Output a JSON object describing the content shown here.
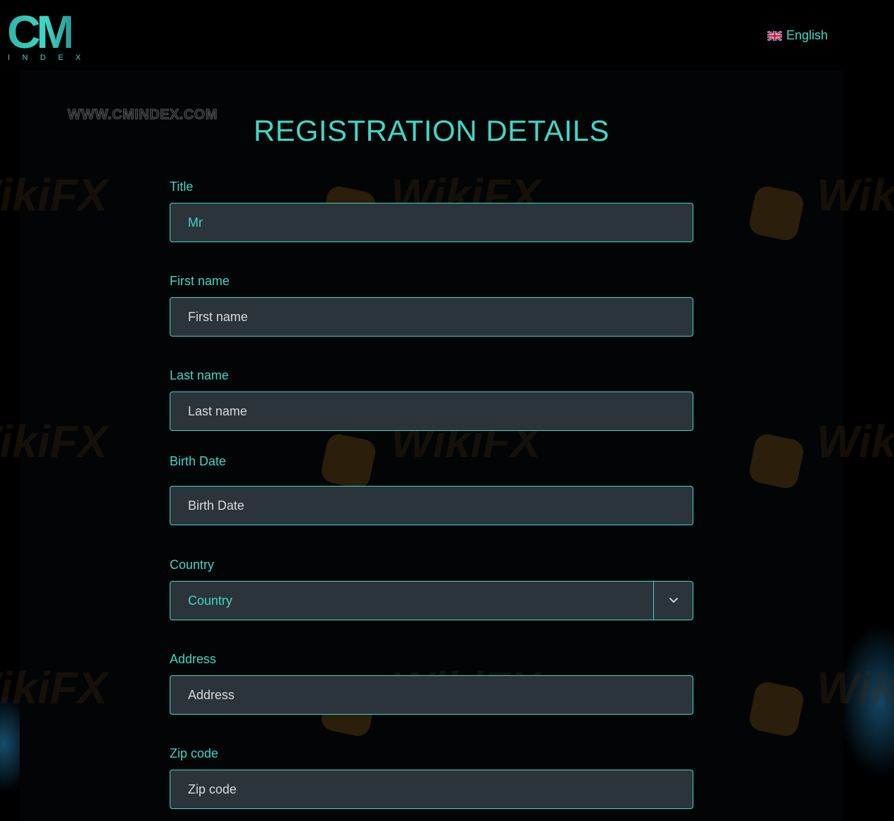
{
  "brand": {
    "logo_main": "CM",
    "logo_sub": "INDEX",
    "website": "WWW.CMINDEX.COM"
  },
  "language": {
    "label": "English",
    "flag_icon": "uk-flag-icon"
  },
  "form": {
    "heading": "REGISTRATION DETAILS",
    "fields": {
      "title": {
        "label": "Title",
        "value": "Mr"
      },
      "first_name": {
        "label": "First name",
        "placeholder": "First name"
      },
      "last_name": {
        "label": "Last name",
        "placeholder": "Last name"
      },
      "birth_date": {
        "label": "Birth Date",
        "placeholder": "Birth Date"
      },
      "country": {
        "label": "Country",
        "selected": "Country",
        "icon": "chevron-down-icon"
      },
      "address": {
        "label": "Address",
        "placeholder": "Address"
      },
      "zip_code": {
        "label": "Zip code",
        "placeholder": "Zip code"
      }
    }
  },
  "watermark": {
    "text": "WikiFX"
  },
  "colors": {
    "accent": "#3fd7c6",
    "field_bg": "#2b343b",
    "page_bg": "#000000"
  }
}
